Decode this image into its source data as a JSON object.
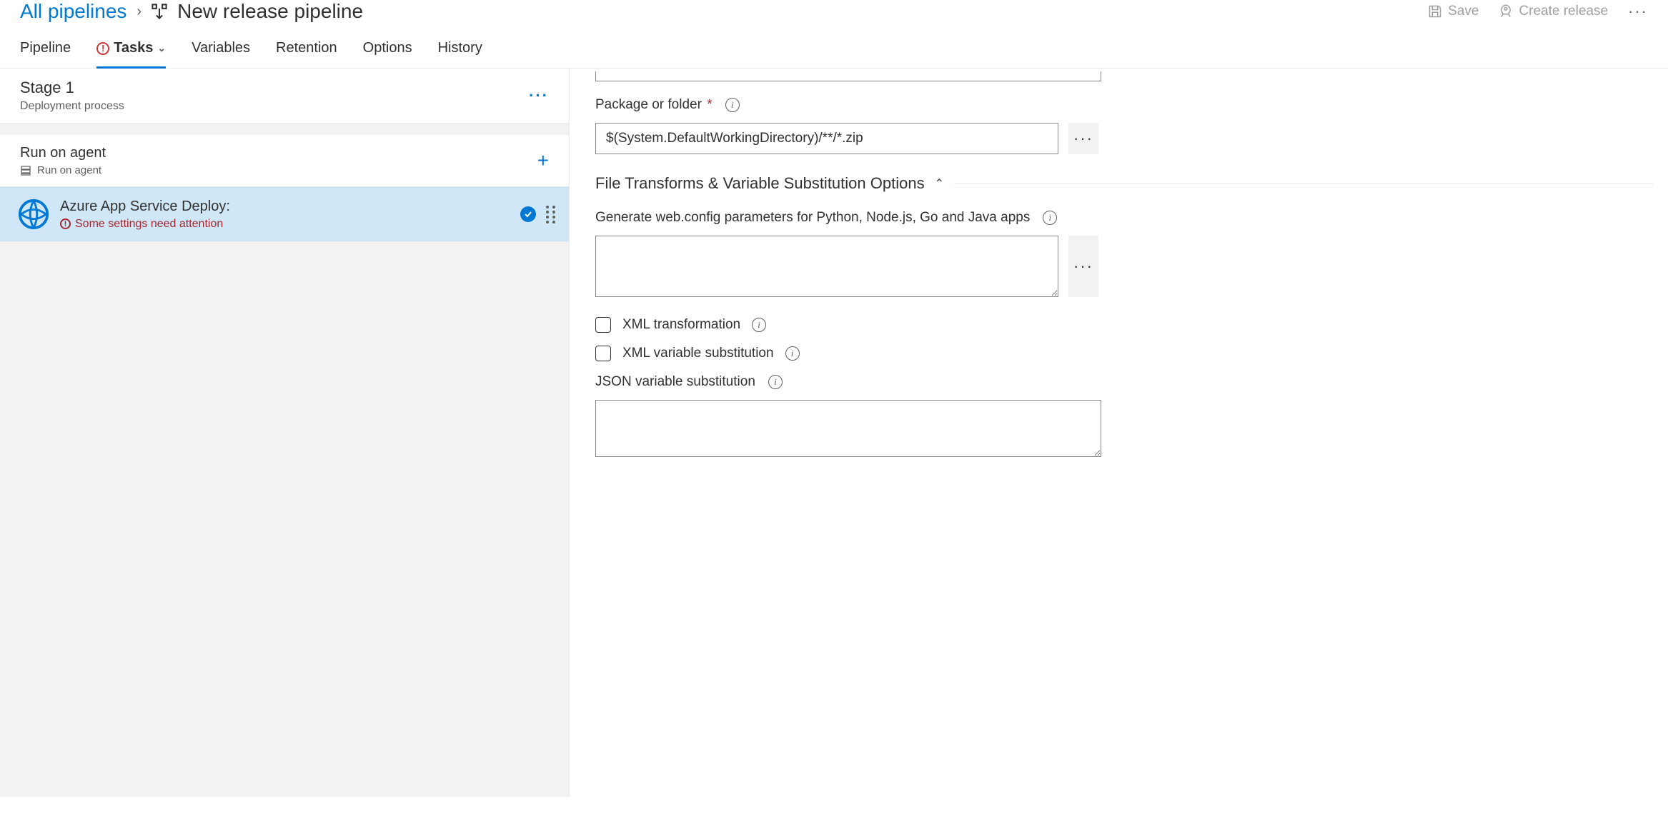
{
  "breadcrumb": {
    "root": "All pipelines",
    "current": "New release pipeline"
  },
  "header_actions": {
    "save": "Save",
    "create_release": "Create release"
  },
  "tabs": {
    "pipeline": "Pipeline",
    "tasks": "Tasks",
    "variables": "Variables",
    "retention": "Retention",
    "options": "Options",
    "history": "History"
  },
  "left": {
    "stage_title": "Stage 1",
    "stage_sub": "Deployment process",
    "agent_title": "Run on agent",
    "agent_sub": "Run on agent",
    "task_title": "Azure App Service Deploy:",
    "task_error": "Some settings need attention"
  },
  "form": {
    "package_label": "Package or folder",
    "package_value": "$(System.DefaultWorkingDirectory)/**/*.zip",
    "section_title": "File Transforms & Variable Substitution Options",
    "webconfig_label": "Generate web.config parameters for Python, Node.js, Go and Java apps",
    "webconfig_value": "",
    "xml_transform": "XML transformation",
    "xml_varsub": "XML variable substitution",
    "json_varsub": "JSON variable substitution",
    "json_value": ""
  }
}
